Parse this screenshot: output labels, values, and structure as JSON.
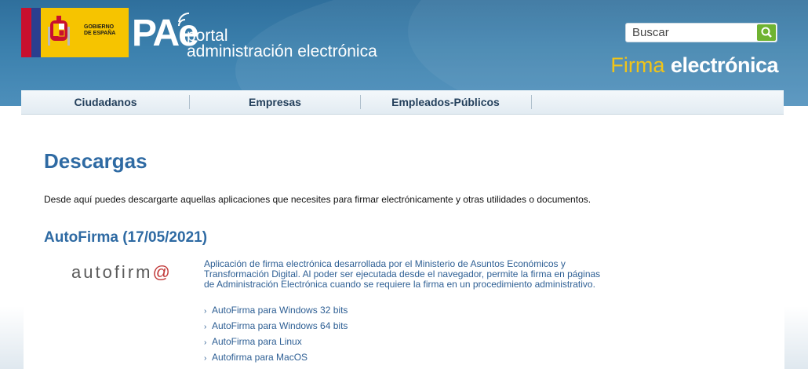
{
  "header": {
    "gov_logo_text": [
      "GOBIERNO",
      "DE ESPAÑA"
    ],
    "pae_big": "PAe",
    "pae_portal": "portal",
    "pae_admin": "administración electrónica",
    "search_placeholder": "Buscar",
    "firma_a": "Firma",
    "firma_b": "electrónica"
  },
  "nav": {
    "items": [
      "Ciudadanos",
      "Empresas",
      "Empleados-Públicos"
    ]
  },
  "main": {
    "title": "Descargas",
    "intro": "Desde aquí puedes descargarte aquellas aplicaciones que necesites para firmar electrónicamente y otras utilidades o documentos.",
    "section_title": "AutoFirma (17/05/2021)",
    "logo_text_a": "autofirm",
    "logo_text_b": "@",
    "description": "Aplicación de firma electrónica desarrollada por el Ministerio de Asuntos Económicos y Transformación Digital. Al poder ser ejecutada desde el navegador, permite la firma en páginas de Administración Electrónica cuando se requiere la firma en un procedimiento administrativo.",
    "links": [
      "AutoFirma para Windows 32 bits",
      "AutoFirma para Windows 64 bits",
      "AutoFirma para Linux",
      "Autofirma para MacOS"
    ]
  },
  "colors": {
    "header_blue": "#3b80ad",
    "title_blue": "#2e6aa3",
    "link_blue": "#2e5f94",
    "gov_yellow": "#f6c400",
    "search_green": "#6fb331"
  },
  "icons": [
    "search-icon",
    "chevron-right-icon",
    "coat-of-arms-icon",
    "wifi-signal-icon"
  ]
}
